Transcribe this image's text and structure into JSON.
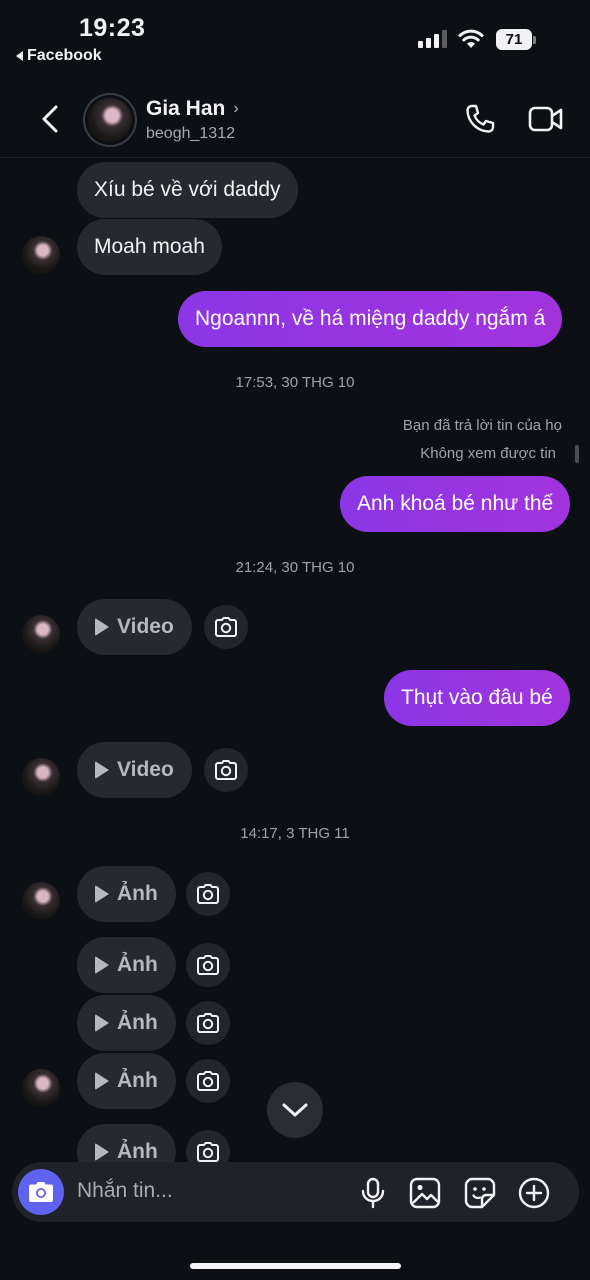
{
  "status_bar": {
    "time": "19:23",
    "back_app": "Facebook",
    "battery": "71"
  },
  "header": {
    "name": "Gia Han",
    "username": "beogh_1312"
  },
  "messages": {
    "m1": "Xíu bé về với daddy",
    "m2": "Moah moah",
    "m3": "Ngoannn, về há miệng daddy ngắm á",
    "ts1": "17:53, 30 THG 10",
    "note1": "Bạn đã trả lời tin của họ",
    "note2": "Không xem được tin",
    "m4": "Anh khoá bé như thế",
    "ts2": "21:24, 30 THG 10",
    "video1": "Video",
    "m5": "Thụt vào đâu bé",
    "video2": "Video",
    "ts3": "14:17, 3 THG 11",
    "photo1": "Ảnh",
    "photo2": "Ảnh",
    "photo3": "Ảnh",
    "photo4": "Ảnh",
    "photo5": "Ảnh"
  },
  "composer": {
    "placeholder": "Nhắn tin..."
  },
  "colors": {
    "background": "#0c0f14",
    "outgoing_bubble": "#9a32e0",
    "incoming_bubble": "#26292f",
    "composer_camera": "#5f62ee"
  }
}
